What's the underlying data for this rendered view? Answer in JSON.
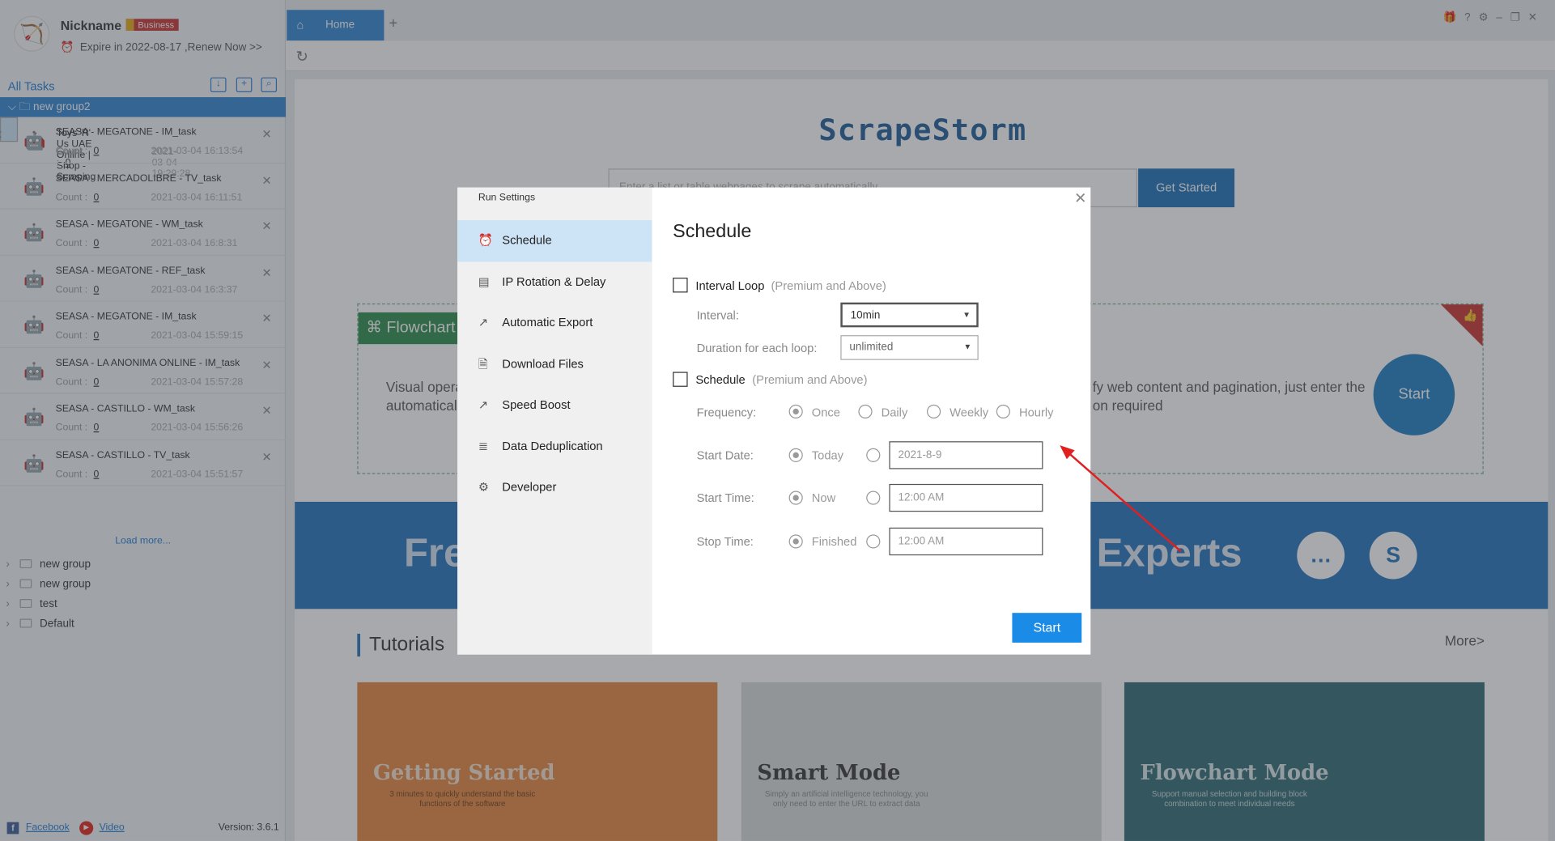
{
  "profile": {
    "nickname": "Nickname",
    "badge": "Business",
    "expire": "Expire in 2022-08-17 ,Renew Now >>"
  },
  "sidebar": {
    "all_tasks": "All Tasks",
    "open_group": "new group2",
    "tasks": [
      {
        "name": "Toys 'R' Us UAE Online | Shop -Scraping",
        "count_label": "Count :",
        "count": "0",
        "date": "2021-03-04 19:29:28"
      },
      {
        "name": "SEASA - MEGATONE - IM_task",
        "count_label": "Count :",
        "count": "0",
        "date": "2021-03-04 16:13:54"
      },
      {
        "name": "SEASA - MERCADOLIBRE - TV_task",
        "count_label": "Count :",
        "count": "0",
        "date": "2021-03-04 16:11:51"
      },
      {
        "name": "SEASA - MEGATONE - WM_task",
        "count_label": "Count :",
        "count": "0",
        "date": "2021-03-04 16:8:31"
      },
      {
        "name": "SEASA - MEGATONE - REF_task",
        "count_label": "Count :",
        "count": "0",
        "date": "2021-03-04 16:3:37"
      },
      {
        "name": "SEASA - MEGATONE - IM_task",
        "count_label": "Count :",
        "count": "0",
        "date": "2021-03-04 15:59:15"
      },
      {
        "name": "SEASA - LA ANONIMA ONLINE - IM_task",
        "count_label": "Count :",
        "count": "0",
        "date": "2021-03-04 15:57:28"
      },
      {
        "name": "SEASA - CASTILLO - WM_task",
        "count_label": "Count :",
        "count": "0",
        "date": "2021-03-04 15:56:26"
      },
      {
        "name": "SEASA - CASTILLO - TV_task",
        "count_label": "Count :",
        "count": "0",
        "date": "2021-03-04 15:51:57"
      }
    ],
    "load_more": "Load more...",
    "groups": [
      "new group",
      "new group",
      "test",
      "Default"
    ],
    "footer": {
      "facebook": "Facebook",
      "video": "Video",
      "version": "Version: 3.6.1"
    }
  },
  "tabs": {
    "home": "Home"
  },
  "main": {
    "logo": "ScrapeStorm",
    "search_placeholder": "Enter a list or table webpages to scrape automatically",
    "get_started": "Get Started",
    "flowchart_tag": "Flowchart",
    "feature_left": "Visual opera\nautomatically",
    "feature_right": "fy web content and pagination, just enter the\non required",
    "start_circle": "Start",
    "banner_left": "Fre",
    "banner_right": "Experts",
    "tutorials": "Tutorials",
    "more": "More>",
    "cards": [
      {
        "title": "Getting Started",
        "sub": "3 minutes to quickly understand the basic functions of the software",
        "bg": "#e8863d"
      },
      {
        "title": "Smart Mode",
        "sub": "Simply an artificial intelligence technology, you only need to enter the URL to extract data",
        "bg": "#d9dadb"
      },
      {
        "title": "Flowchart Mode",
        "sub": "Support manual selection and building block combination to meet individual needs",
        "bg": "#2f6b73"
      }
    ]
  },
  "modal": {
    "title": "Run Settings",
    "nav": [
      {
        "label": "Schedule",
        "icon": "alarm-clock-icon"
      },
      {
        "label": "IP Rotation & Delay",
        "icon": "ip-rotation-icon"
      },
      {
        "label": "Automatic Export",
        "icon": "export-icon"
      },
      {
        "label": "Download Files",
        "icon": "download-file-icon"
      },
      {
        "label": "Speed Boost",
        "icon": "speed-boost-icon"
      },
      {
        "label": "Data Deduplication",
        "icon": "deduplication-icon"
      },
      {
        "label": "Developer",
        "icon": "gear-icon"
      }
    ],
    "heading": "Schedule",
    "interval_loop": "Interval Loop",
    "interval_note": "(Premium and Above)",
    "interval_label": "Interval:",
    "interval_value": "10min",
    "duration_label": "Duration for each loop:",
    "duration_value": "unlimited",
    "schedule": "Schedule",
    "schedule_note": "(Premium and Above)",
    "frequency_label": "Frequency:",
    "freq_options": [
      "Once",
      "Daily",
      "Weekly",
      "Hourly"
    ],
    "start_date_label": "Start Date:",
    "today": "Today",
    "start_date_value": "2021-8-9",
    "start_time_label": "Start Time:",
    "now": "Now",
    "start_time_value": "12:00 AM",
    "stop_time_label": "Stop Time:",
    "finished": "Finished",
    "stop_time_value": "12:00 AM",
    "start": "Start"
  },
  "colors": {
    "accent": "#2f83d1",
    "start_button": "#1a8ce8",
    "annotation_arrow": "#e02020"
  }
}
